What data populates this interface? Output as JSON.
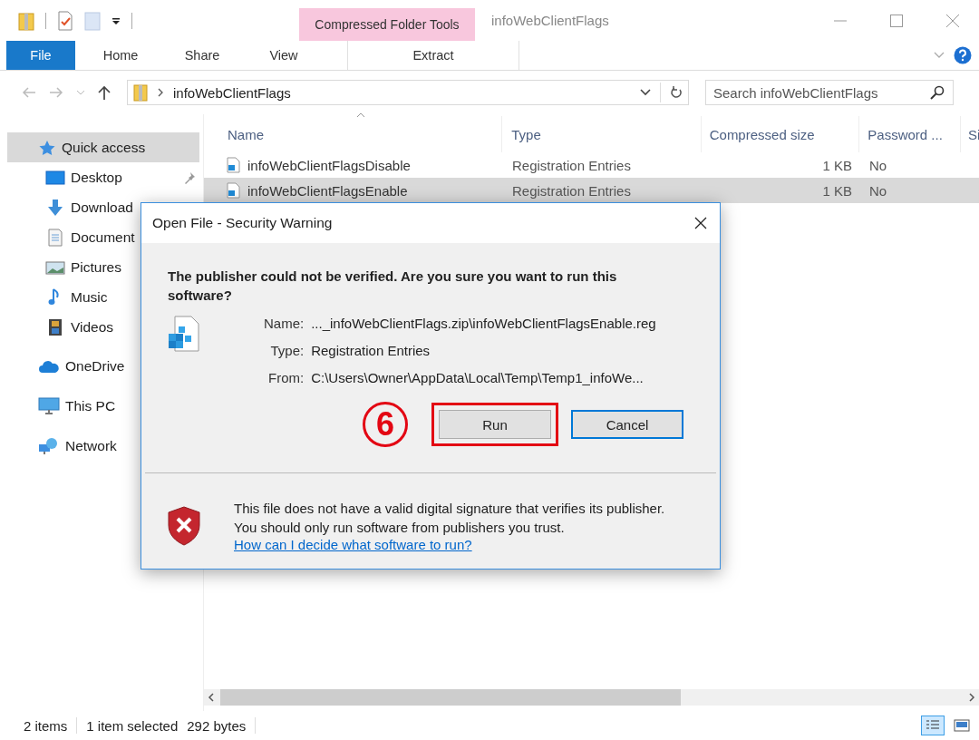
{
  "window": {
    "title": "infoWebClientFlags",
    "context_group": "Compressed Folder Tools"
  },
  "ribbon_tabs": [
    {
      "label": "File",
      "kind": "file"
    },
    {
      "label": "Home",
      "kind": "tab"
    },
    {
      "label": "Share",
      "kind": "tab"
    },
    {
      "label": "View",
      "kind": "tab"
    },
    {
      "label": "Extract",
      "kind": "context"
    }
  ],
  "address": {
    "path": "infoWebClientFlags"
  },
  "search": {
    "placeholder": "Search infoWebClientFlags"
  },
  "sidebar": {
    "items": [
      {
        "label": "Quick access",
        "selected": true,
        "children": [
          {
            "label": "Desktop",
            "pinned": true
          },
          {
            "label": "Download",
            "pinned": false
          },
          {
            "label": "Document",
            "pinned": false
          },
          {
            "label": "Pictures",
            "pinned": false
          },
          {
            "label": "Music",
            "pinned": false
          },
          {
            "label": "Videos",
            "pinned": false
          }
        ]
      },
      {
        "label": "OneDrive",
        "selected": false
      },
      {
        "label": "This PC",
        "selected": false
      },
      {
        "label": "Network",
        "selected": false
      }
    ]
  },
  "table": {
    "columns": [
      "Name",
      "Type",
      "Compressed size",
      "Password ...",
      "Si"
    ],
    "rows": [
      {
        "name": "infoWebClientFlagsDisable",
        "type": "Registration Entries",
        "compressed_size": "1 KB",
        "password": "No",
        "selected": false
      },
      {
        "name": "infoWebClientFlagsEnable",
        "type": "Registration Entries",
        "compressed_size": "1 KB",
        "password": "No",
        "selected": true
      }
    ]
  },
  "status_bar": {
    "count": "2 items",
    "selection": "1 item selected",
    "size": "292 bytes"
  },
  "dialog": {
    "title": "Open File - Security Warning",
    "question": "The publisher could not be verified.  Are you sure you want to run this software?",
    "fields": [
      {
        "label": "Name:",
        "value": "..._infoWebClientFlags.zip\\infoWebClientFlagsEnable.reg"
      },
      {
        "label": "Type:",
        "value": "Registration Entries"
      },
      {
        "label": "From:",
        "value": "C:\\Users\\Owner\\AppData\\Local\\Temp\\Temp1_infoWe..."
      }
    ],
    "buttons": [
      {
        "label": "Run",
        "focused": false,
        "marked": true
      },
      {
        "label": "Cancel",
        "focused": true,
        "marked": false
      }
    ],
    "warning": "This file does not have a valid digital signature that verifies its publisher.  You should only run software from publishers you trust.",
    "help_link": "How can I decide what software to run?"
  },
  "callout": {
    "label": "6"
  }
}
